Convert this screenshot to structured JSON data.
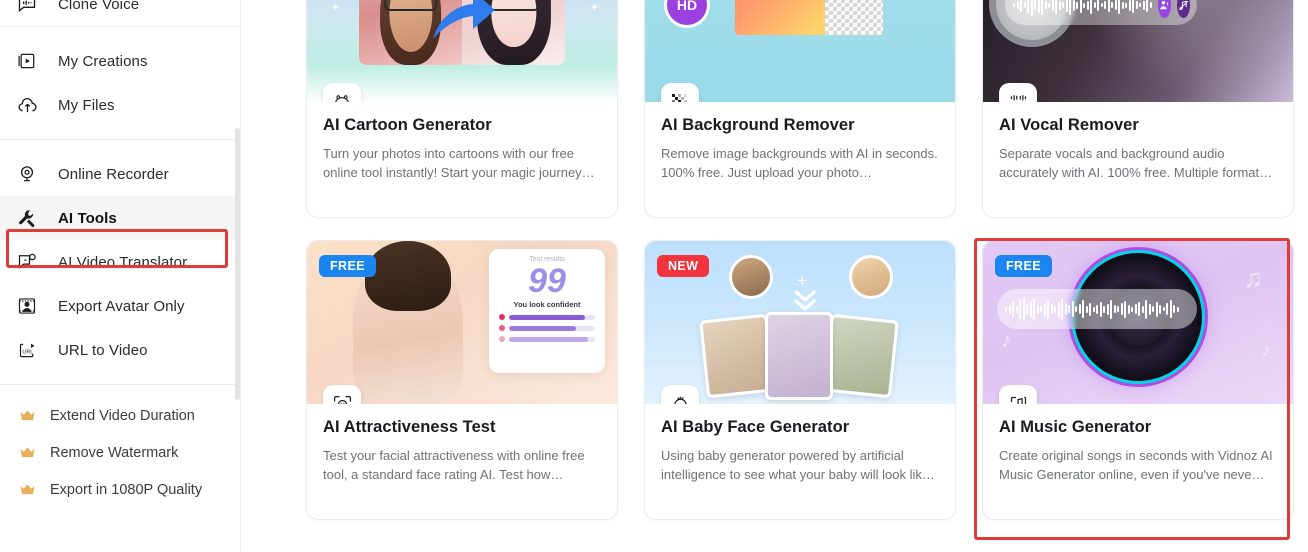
{
  "sidebar": {
    "clipped_item": {
      "label": "Clone Voice",
      "icon": "clone-voice-icon"
    },
    "groups": [
      {
        "items": [
          {
            "label": "My Creations",
            "icon": "my-creations-icon",
            "active": false
          },
          {
            "label": "My Files",
            "icon": "my-files-icon",
            "active": false
          }
        ]
      },
      {
        "items": [
          {
            "label": "Online Recorder",
            "icon": "online-recorder-icon",
            "active": false
          },
          {
            "label": "AI Tools",
            "icon": "ai-tools-icon",
            "active": true
          },
          {
            "label": "AI Video Translator",
            "icon": "ai-video-translator-icon",
            "active": false
          },
          {
            "label": "Export Avatar Only",
            "icon": "export-avatar-only-icon",
            "active": false
          },
          {
            "label": "URL to Video",
            "icon": "url-to-video-icon",
            "active": false
          }
        ]
      }
    ],
    "pro_features": [
      {
        "label": "Extend Video Duration",
        "icon": "crown-icon"
      },
      {
        "label": "Remove Watermark",
        "icon": "crown-icon"
      },
      {
        "label": "Export in 1080P Quality",
        "icon": "crown-icon"
      }
    ]
  },
  "colors": {
    "accent_blue": "#1a84f0",
    "badge_new_red": "#f0333c",
    "annotation_red": "#e03b3b",
    "active_bg": "#f5f5f5",
    "crown_gold": "#e8b котор"
  },
  "cards": [
    {
      "title": "AI Cartoon Generator",
      "description": "Turn your photos into cartoons with our free online tool instantly! Start your magic journey…",
      "badge": null,
      "icon": "cartoon-face-icon",
      "highlighted": false
    },
    {
      "title": "AI Background Remover",
      "description": "Remove image backgrounds with AI in seconds. 100% free. Just upload your photo…",
      "badge": null,
      "overlay_label": "HD",
      "icon": "checkerboard-icon",
      "highlighted": false
    },
    {
      "title": "AI Vocal Remover",
      "description": "Separate vocals and background audio accurately with AI. 100% free. Multiple format…",
      "badge": null,
      "icon": "microphone-icon",
      "highlighted": false
    },
    {
      "title": "AI Attractiveness Test",
      "description": "Test your facial attractiveness with online free tool, a standard face rating AI. Test how…",
      "badge": "FREE",
      "badge_type": "free",
      "icon": "face-scan-icon",
      "highlighted": false,
      "artwork": {
        "result_label": "Test results",
        "result_score": "99",
        "result_caption": "You look confident"
      }
    },
    {
      "title": "AI Baby Face Generator",
      "description": "Using baby generator powered by artificial intelligence to see what your baby will look lik…",
      "badge": "NEW",
      "badge_type": "new",
      "icon": "baby-face-icon",
      "highlighted": false
    },
    {
      "title": "AI Music Generator",
      "description": "Create original songs in seconds with Vidnoz AI Music Generator online, even if you've neve…",
      "badge": "FREE",
      "badge_type": "free",
      "icon": "music-ai-icon",
      "highlighted": true
    }
  ]
}
